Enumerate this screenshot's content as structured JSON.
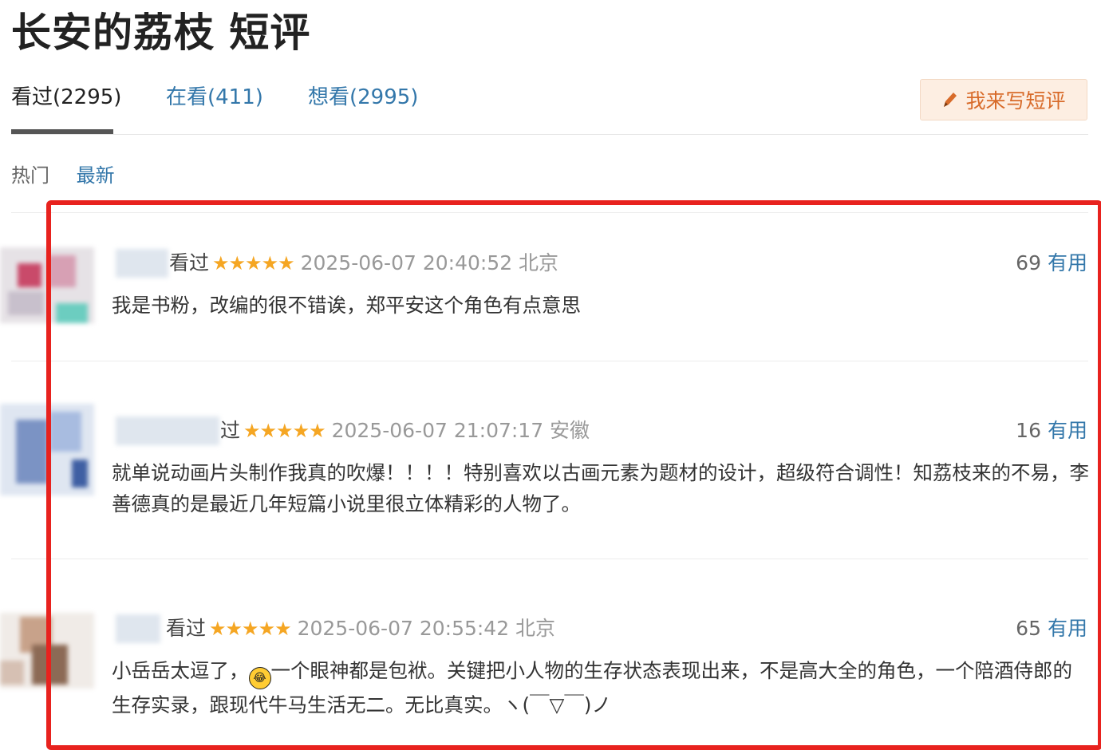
{
  "page": {
    "title": "长安的荔枝 短评"
  },
  "tabs": [
    {
      "label": "看过(2295)"
    },
    {
      "label": "在看(411)"
    },
    {
      "label": "想看(2995)"
    }
  ],
  "write_button": {
    "label": "我来写短评",
    "icon": "pencil-icon"
  },
  "sort": {
    "hot": "热门",
    "latest": "最新"
  },
  "colors": {
    "highlight": "#e8221e",
    "star": "#f5a623",
    "link": "#3377aa",
    "button_bg": "#fdeee2"
  },
  "comments": [
    {
      "status": "看过",
      "status_visible": "看过",
      "stars": "★★★★★",
      "rating": 5,
      "time": "2025-06-07 20:40:52 北京",
      "votes": "69",
      "useful": "有用",
      "content": "我是书粉，改编的很不错诶，郑平安这个角色有点意思"
    },
    {
      "status": "看过",
      "status_visible": "过",
      "stars": "★★★★★",
      "rating": 5,
      "time": "2025-06-07 21:07:17 安徽",
      "votes": "16",
      "useful": "有用",
      "content": "就单说动画片头制作我真的吹爆！！！！特别喜欢以古画元素为题材的设计，超级符合调性！知荔枝来的不易，李善德真的是最近几年短篇小说里很立体精彩的人物了。"
    },
    {
      "status": "看过",
      "status_visible": "看过",
      "stars": "★★★★★",
      "rating": 5,
      "time": "2025-06-07 20:55:42 北京",
      "votes": "65",
      "useful": "有用",
      "content_part1": "小岳岳太逗了，",
      "emoji": "😂",
      "content_part2": "一个眼神都是包袱。关键把小人物的生存状态表现出来，不是高大全的角色，一个陪酒侍郎的生存实录，跟现代牛马生活无二。无比真实。ヽ(￣▽￣)ノ"
    }
  ]
}
